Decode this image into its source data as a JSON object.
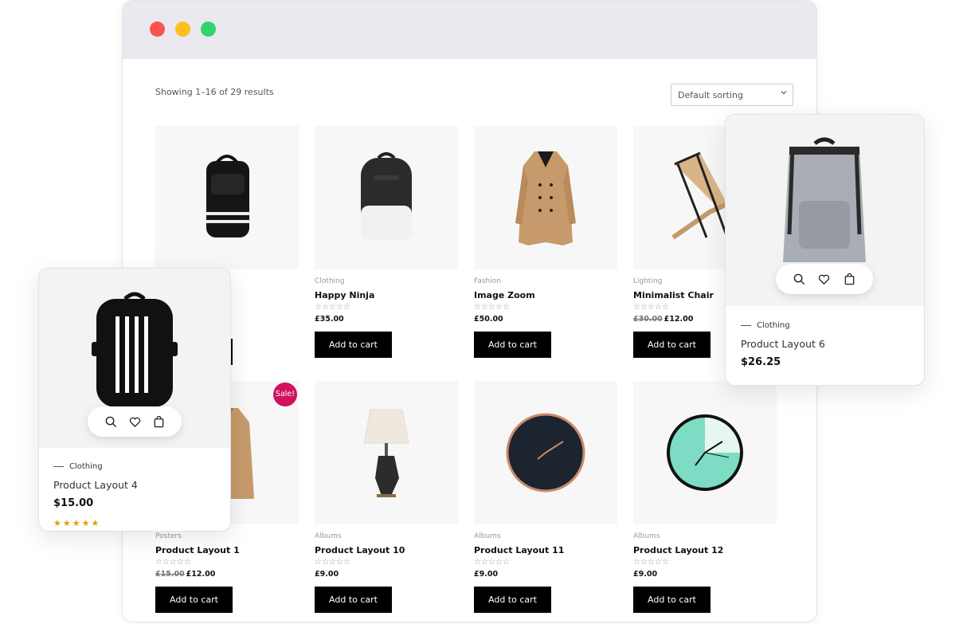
{
  "shop": {
    "result_count": "Showing 1–16 of 29 results",
    "sorting": "Default sorting",
    "add_to_cart": "Add to cart",
    "sale_badge": "Sale!",
    "rating_empty": "☆☆☆☆☆",
    "products": [
      {
        "category": "Clothing",
        "name": "Happy Ninja",
        "price": "£35.00",
        "old_price": ""
      },
      {
        "category": "Fashion",
        "name": "Image Zoom",
        "price": "£50.00",
        "old_price": ""
      },
      {
        "category": "Lighting",
        "name": "Minimalist Chair",
        "price": "£12.00",
        "old_price": "£30.00"
      },
      {
        "category": "Posters",
        "name": "Product Layout 1",
        "price": "£12.00",
        "old_price": "£15.00"
      },
      {
        "category": "Albums",
        "name": "Product Layout 10",
        "price": "£9.00",
        "old_price": ""
      },
      {
        "category": "Albums",
        "name": "Product Layout 11",
        "price": "£9.00",
        "old_price": ""
      },
      {
        "category": "Albums",
        "name": "Product Layout 12",
        "price": "£9.00",
        "old_price": ""
      }
    ]
  },
  "popup_left": {
    "category": "Clothing",
    "name": "Product Layout 4",
    "price": "$15.00",
    "stars": "★★★★★",
    "rating": 5
  },
  "popup_right": {
    "category": "Clothing",
    "name": "Product Layout 6",
    "price": "$26.25"
  },
  "colors": {
    "sale_badge": "#d2115f",
    "star_fill": "#e0a100",
    "close_dot": "#fd5150",
    "minimize_dot": "#fdc020",
    "maximize_dot": "#34d26a"
  },
  "icons": [
    "search-icon",
    "heart-icon",
    "bag-icon"
  ]
}
